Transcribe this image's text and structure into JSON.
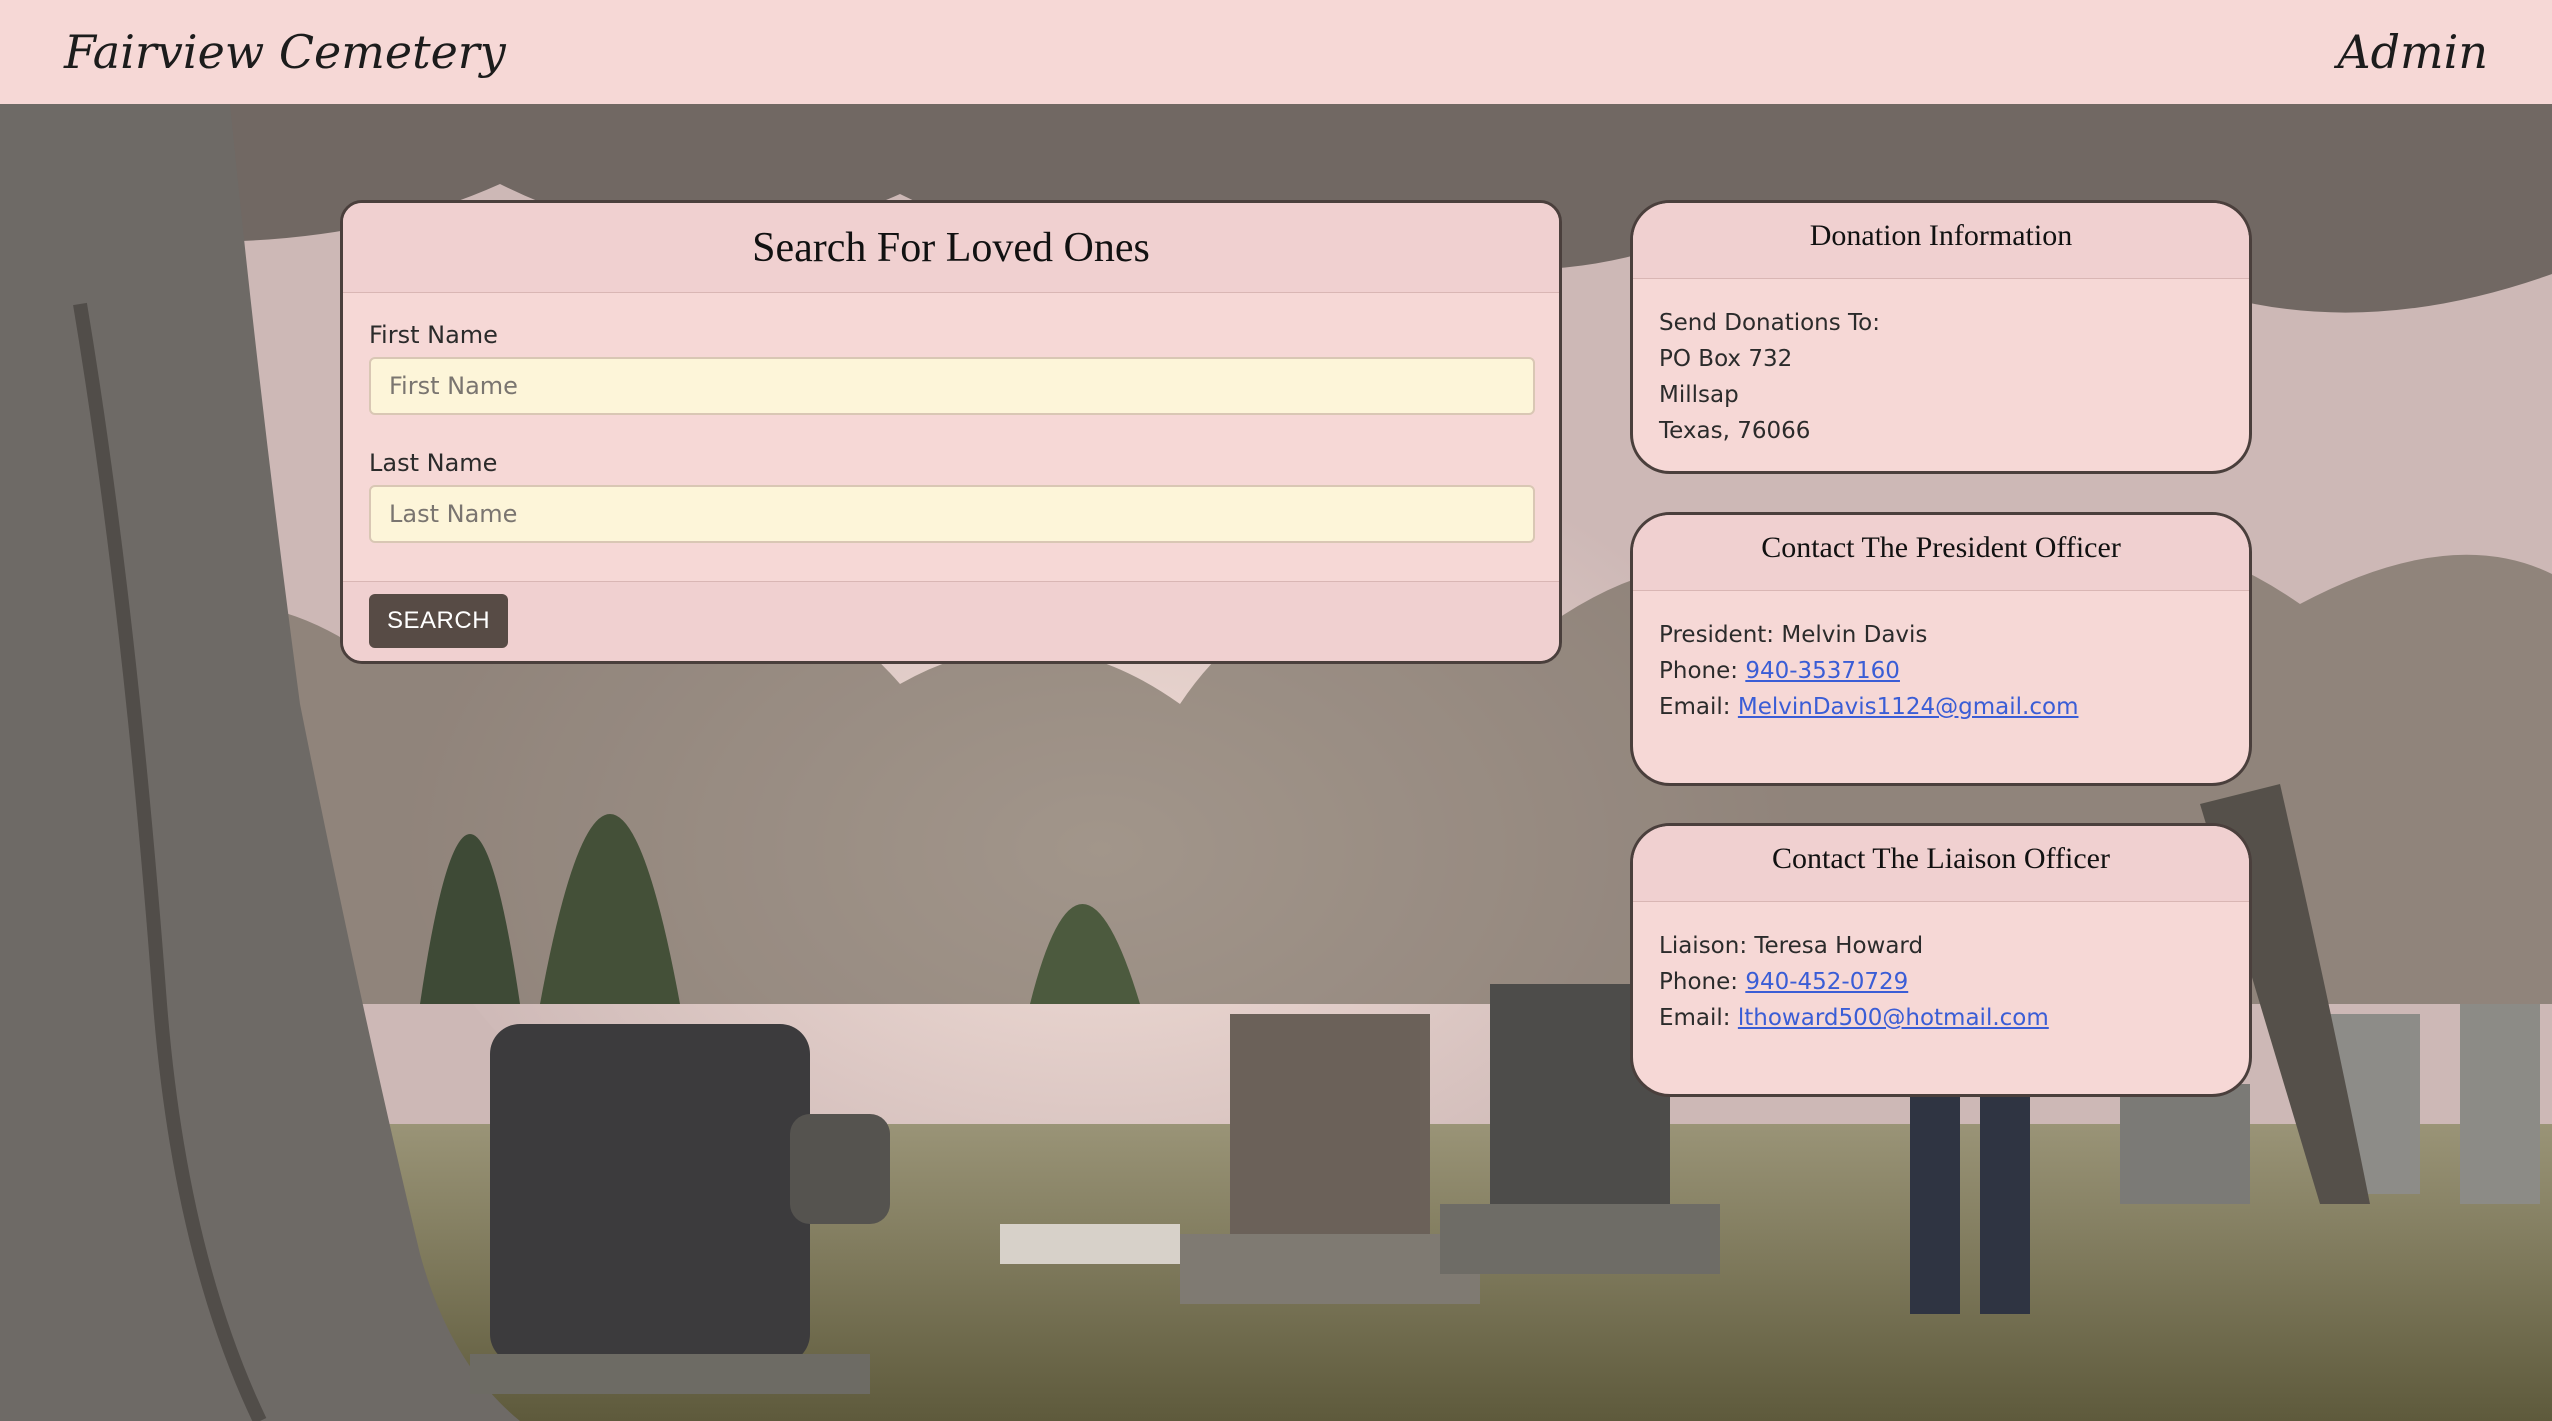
{
  "nav": {
    "brand": "Fairview Cemetery",
    "admin": "Admin"
  },
  "search": {
    "title": "Search For Loved Ones",
    "first_name_label": "First Name",
    "first_name_placeholder": "First Name",
    "first_name_value": "",
    "last_name_label": "Last Name",
    "last_name_placeholder": "Last Name",
    "last_name_value": "",
    "button_label": "SEARCH"
  },
  "donation": {
    "title": "Donation Information",
    "lines": [
      "Send Donations To:",
      "PO Box 732",
      "Millsap",
      "Texas, 76066"
    ]
  },
  "president": {
    "title": "Contact The President Officer",
    "name_line": "President: Melvin Davis",
    "phone_label": "Phone:",
    "phone": "940-3537160",
    "email_label": "Email:",
    "email": "MelvinDavis1124@gmail.com"
  },
  "liaison": {
    "title": "Contact The Liaison Officer",
    "name_line": "Liaison: Teresa Howard",
    "phone_label": "Phone:",
    "phone": "940-452-0729",
    "email_label": "Email:",
    "email": "lthoward500@hotmail.com"
  },
  "colors": {
    "navbar_bg": "#f6d8d6",
    "card_bg": "#f6d8d6",
    "input_bg": "#fdf5d9",
    "button_bg": "#574b45",
    "link": "#3a5dd6"
  },
  "background_image": "cemetery-photo"
}
